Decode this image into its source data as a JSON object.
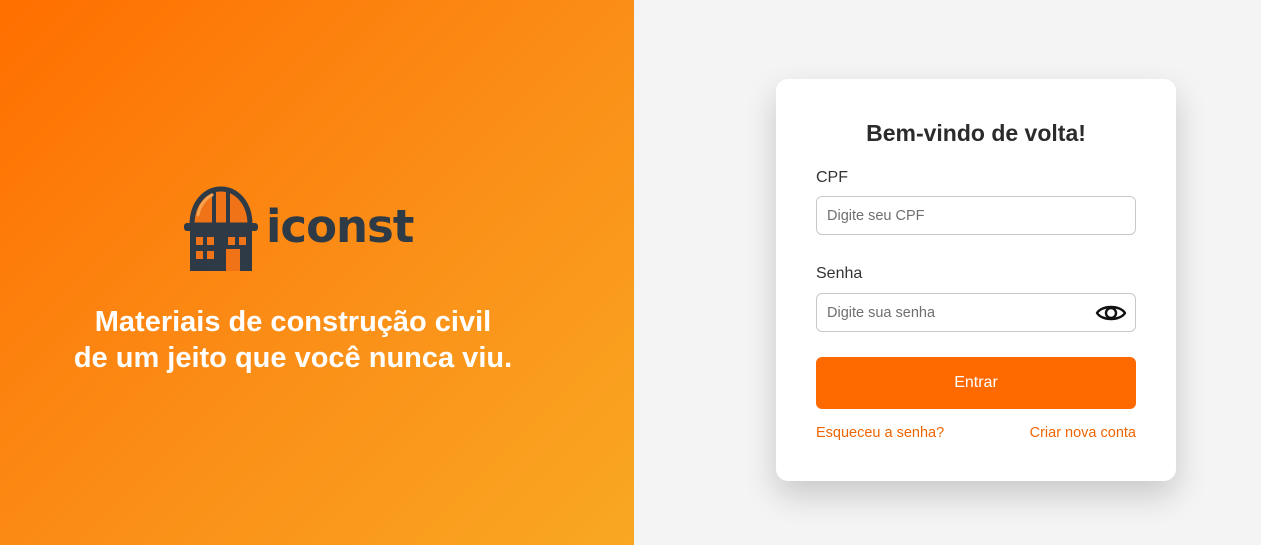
{
  "hero": {
    "brand_name": "iconst",
    "tagline_line1": "Materiais de construção civil",
    "tagline_line2": "de um jeito que você nunca viu.",
    "logo_icon": "hardhat-building-icon",
    "gradient_colors": [
      "#ff6f00",
      "#f9a823"
    ],
    "brand_text_color": "#2e3a45"
  },
  "login": {
    "title": "Bem-vindo de volta!",
    "cpf_label": "CPF",
    "cpf_placeholder": "Digite seu CPF",
    "cpf_value": "",
    "password_label": "Senha",
    "password_placeholder": "Digite sua senha",
    "password_value": "",
    "password_toggle_icon": "eye-icon",
    "submit_label": "Entrar",
    "forgot_label": "Esqueceu a senha?",
    "create_account_label": "Criar nova conta"
  },
  "colors": {
    "accent": "#ff6a00",
    "link": "#f06400",
    "panel_background": "#f4f4f4",
    "card_background": "#ffffff"
  }
}
